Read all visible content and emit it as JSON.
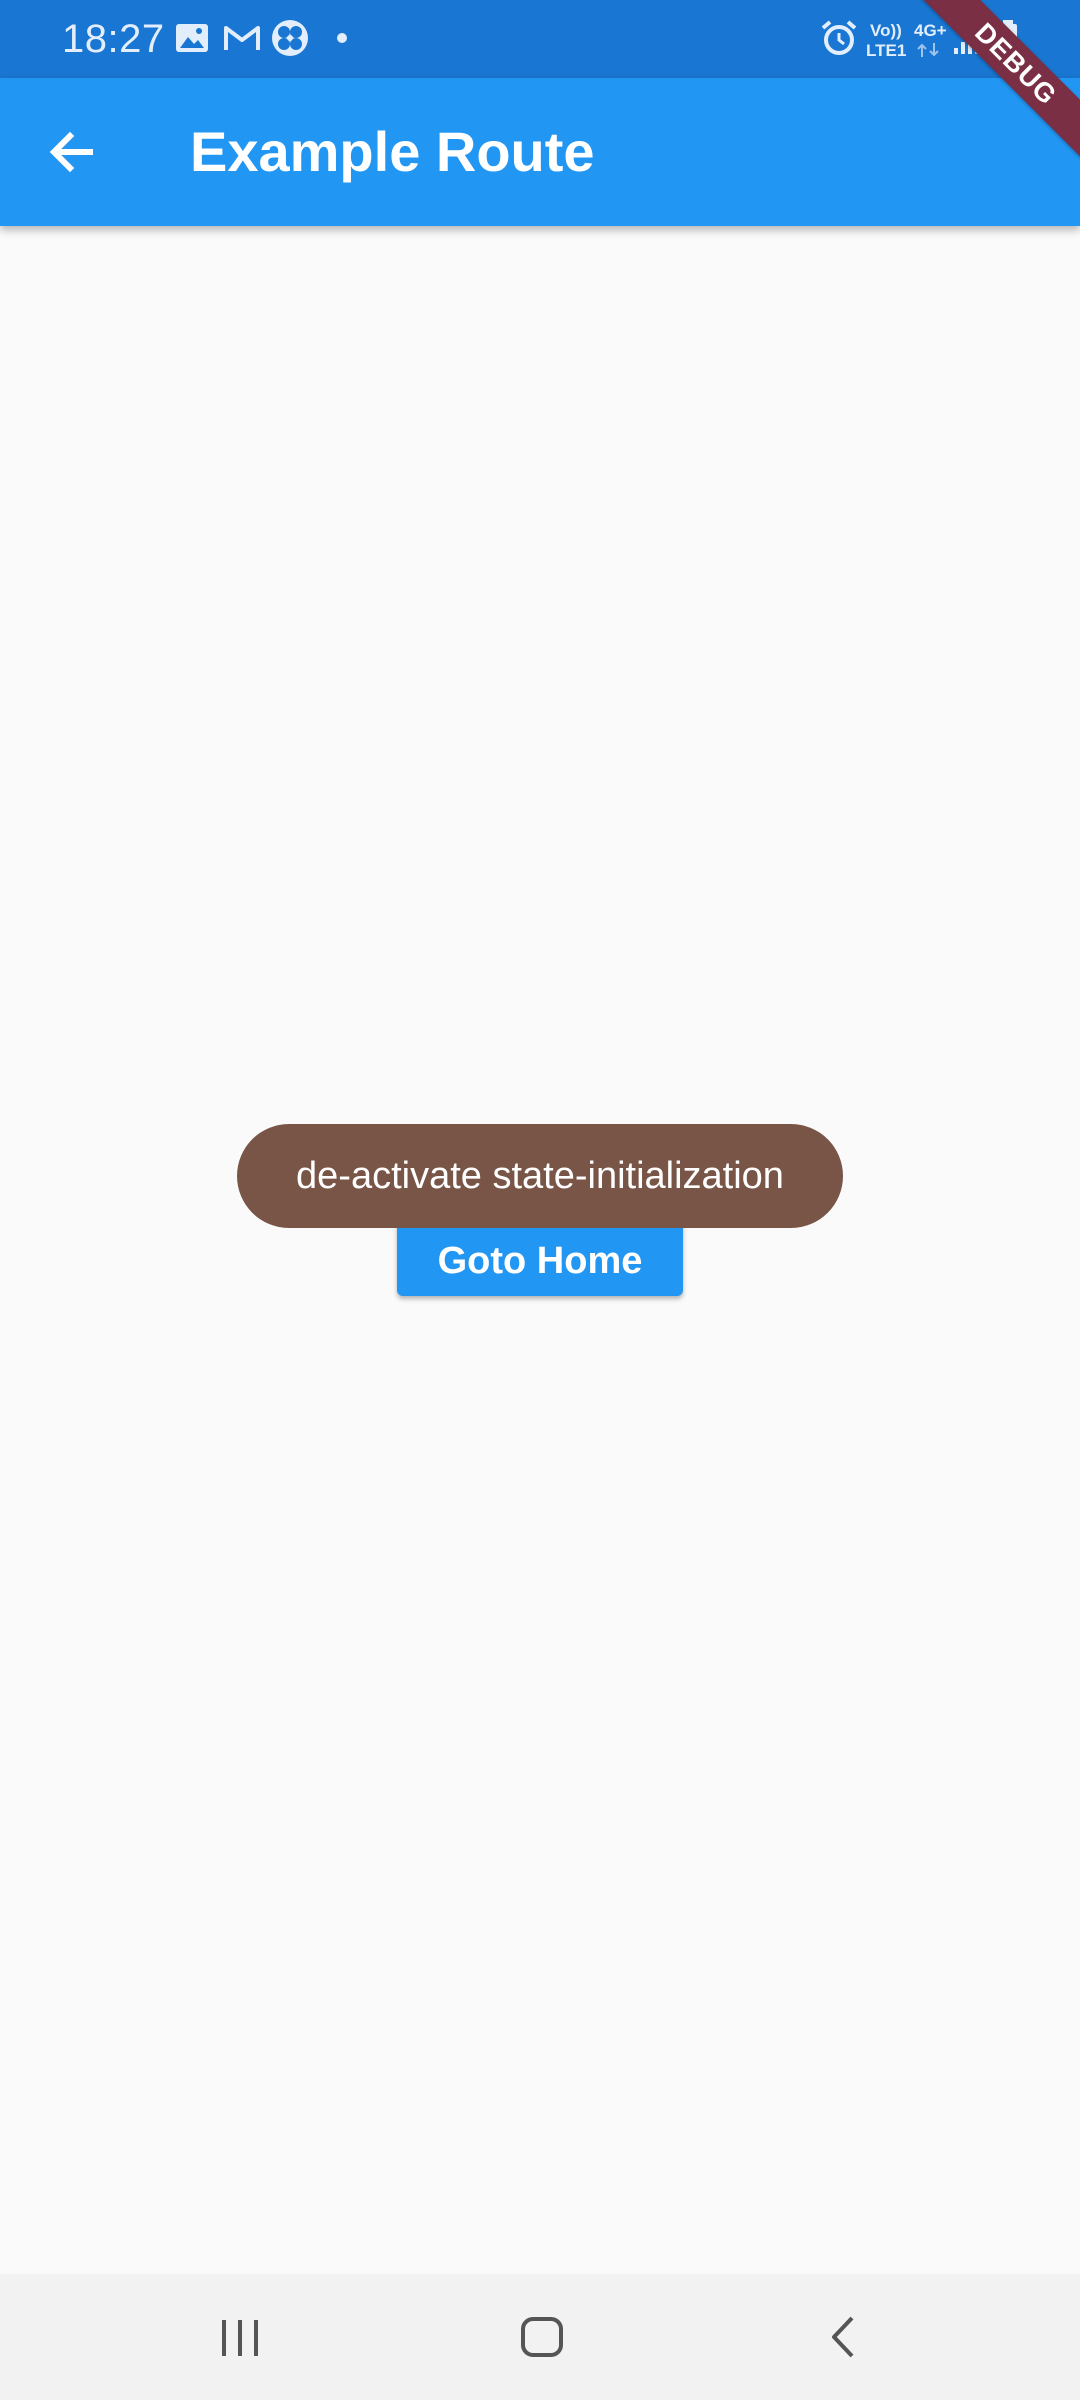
{
  "status_bar": {
    "time": "18:27",
    "volte_top": "Vo))",
    "volte_bottom": "LTE1",
    "network": "4G+",
    "icons": [
      "image-icon",
      "gmail-icon",
      "fan-icon",
      "dot-icon",
      "alarm-icon",
      "signal-icon",
      "battery-icon"
    ]
  },
  "app_bar": {
    "title": "Example Route",
    "back_icon": "arrow-back-icon"
  },
  "debug_banner": "DEBUG",
  "main": {
    "button_label": "Goto Home"
  },
  "toast": {
    "message": "de-activate state-initialization"
  },
  "nav_bar": {
    "icons": [
      "recent-apps-icon",
      "home-icon",
      "back-icon"
    ]
  },
  "colors": {
    "status_bar": "#1976d2",
    "primary": "#2196f3",
    "toast": "#795548",
    "background": "#fafafa"
  }
}
